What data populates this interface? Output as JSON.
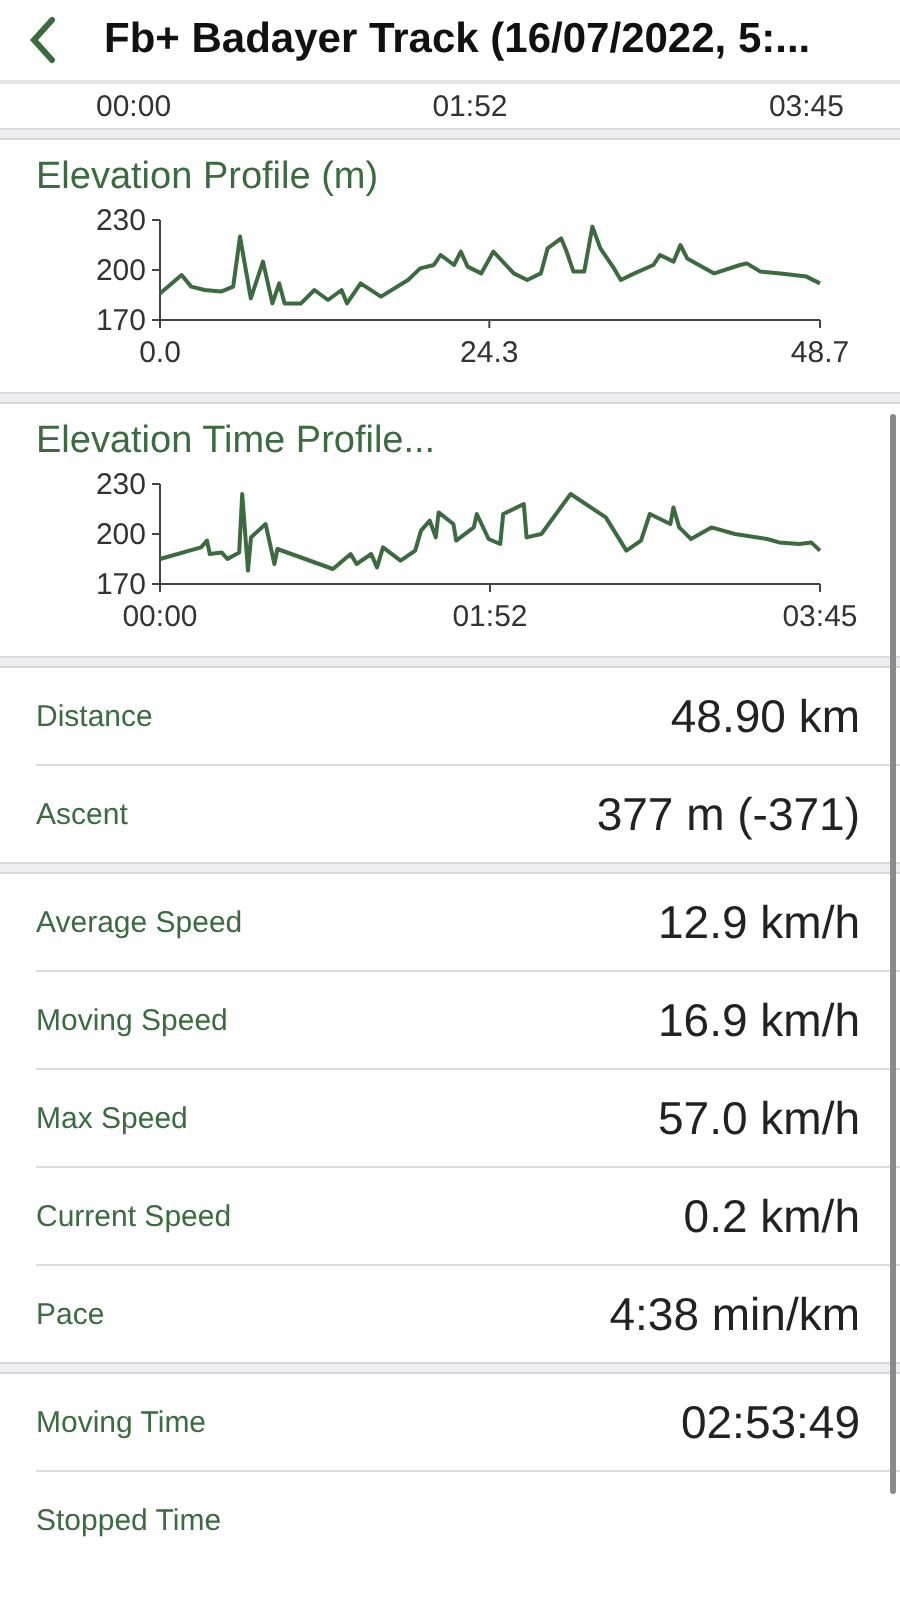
{
  "header": {
    "title": "Fb+ Badayer Track (16/07/2022, 5:..."
  },
  "previous_chart": {
    "xtick_labels": [
      "00:00",
      "01:52",
      "03:45"
    ]
  },
  "charts": [
    {
      "title": "Elevation Profile (m)",
      "chart_data": {
        "type": "line",
        "ylim": [
          170,
          230
        ],
        "yticks": [
          170,
          200,
          230
        ],
        "xlim": [
          0,
          48.7
        ],
        "xticks": [
          {
            "value": 0,
            "label": "0.0"
          },
          {
            "value": 24.3,
            "label": "24.3"
          },
          {
            "value": 48.7,
            "label": "48.7"
          }
        ],
        "x": [
          0,
          1.6,
          2.3,
          3.3,
          4.5,
          5.4,
          5.9,
          6.7,
          7.6,
          8.3,
          8.8,
          9.2,
          10.4,
          11.4,
          12.4,
          13.4,
          13.8,
          14.8,
          16.3,
          18.3,
          19.2,
          20.2,
          20.7,
          21.7,
          22.2,
          22.7,
          23.7,
          24.6,
          26.1,
          27.1,
          28.1,
          28.6,
          29.6,
          30.0,
          30.5,
          31.3,
          31.9,
          32.5,
          33.5,
          34.0,
          35.0,
          36.4,
          36.9,
          37.9,
          38.4,
          38.9,
          40.9,
          42.8,
          43.3,
          44.3,
          45.8,
          47.7,
          48.7
        ],
        "series": [
          {
            "color": "#3b6b3f",
            "values": [
              186,
              197,
              190,
              188,
              187,
              190,
              220,
              183,
              205,
              180,
              192,
              180,
              180,
              188,
              182,
              188,
              180,
              192,
              184,
              194,
              201,
              203,
              209,
              203,
              211,
              202,
              198,
              211,
              198,
              194,
              198,
              213,
              219,
              211,
              199,
              199,
              226,
              213,
              201,
              194,
              198,
              203,
              209,
              205,
              215,
              207,
              198,
              203,
              204,
              199,
              198,
              196,
              192
            ]
          }
        ]
      }
    },
    {
      "title": "Elevation Time Profile...",
      "chart_data": {
        "type": "line",
        "ylim": [
          170,
          230
        ],
        "yticks": [
          170,
          200,
          230
        ],
        "xlim": [
          0,
          225
        ],
        "xticks": [
          {
            "value": 0,
            "label": "00:00"
          },
          {
            "value": 112.5,
            "label": "01:52"
          },
          {
            "value": 225,
            "label": "03:45"
          }
        ],
        "x": [
          0,
          14,
          16,
          17,
          21,
          23,
          27,
          28,
          30,
          31,
          36,
          39,
          40,
          59,
          65,
          67,
          72,
          74,
          76,
          82,
          87,
          89,
          92,
          94,
          95,
          100,
          101,
          107,
          108,
          112,
          116,
          117,
          124,
          125,
          130,
          140,
          152,
          159,
          164,
          167,
          174,
          175,
          177,
          181,
          188,
          196,
          207,
          211,
          218,
          222,
          225
        ],
        "series": [
          {
            "color": "#3b6b3f",
            "values": [
              185,
              192,
              196,
              188,
              189,
              185,
              189,
              224,
              178,
              198,
              206,
              182,
              191,
              179,
              188,
              182,
              188,
              180,
              192,
              184,
              190,
              202,
              208,
              198,
              213,
              206,
              196,
              204,
              212,
              197,
              194,
              212,
              218,
              198,
              200,
              224,
              210,
              190,
              196,
              212,
              206,
              216,
              204,
              197,
              204,
              200,
              197,
              195,
              194,
              195,
              190
            ]
          }
        ]
      }
    }
  ],
  "stat_groups": [
    {
      "rows": [
        {
          "label": "Distance",
          "value": "48.90 km"
        },
        {
          "label": "Ascent",
          "value": "377 m (-371)"
        }
      ]
    },
    {
      "rows": [
        {
          "label": "Average Speed",
          "value": "12.9 km/h"
        },
        {
          "label": "Moving Speed",
          "value": "16.9 km/h"
        },
        {
          "label": "Max Speed",
          "value": "57.0 km/h"
        },
        {
          "label": "Current Speed",
          "value": "0.2 km/h"
        },
        {
          "label": "Pace",
          "value": "4:38 min/km"
        }
      ]
    },
    {
      "rows": [
        {
          "label": "Moving Time",
          "value": "02:53:49"
        },
        {
          "label": "Stopped Time"
        }
      ]
    }
  ]
}
